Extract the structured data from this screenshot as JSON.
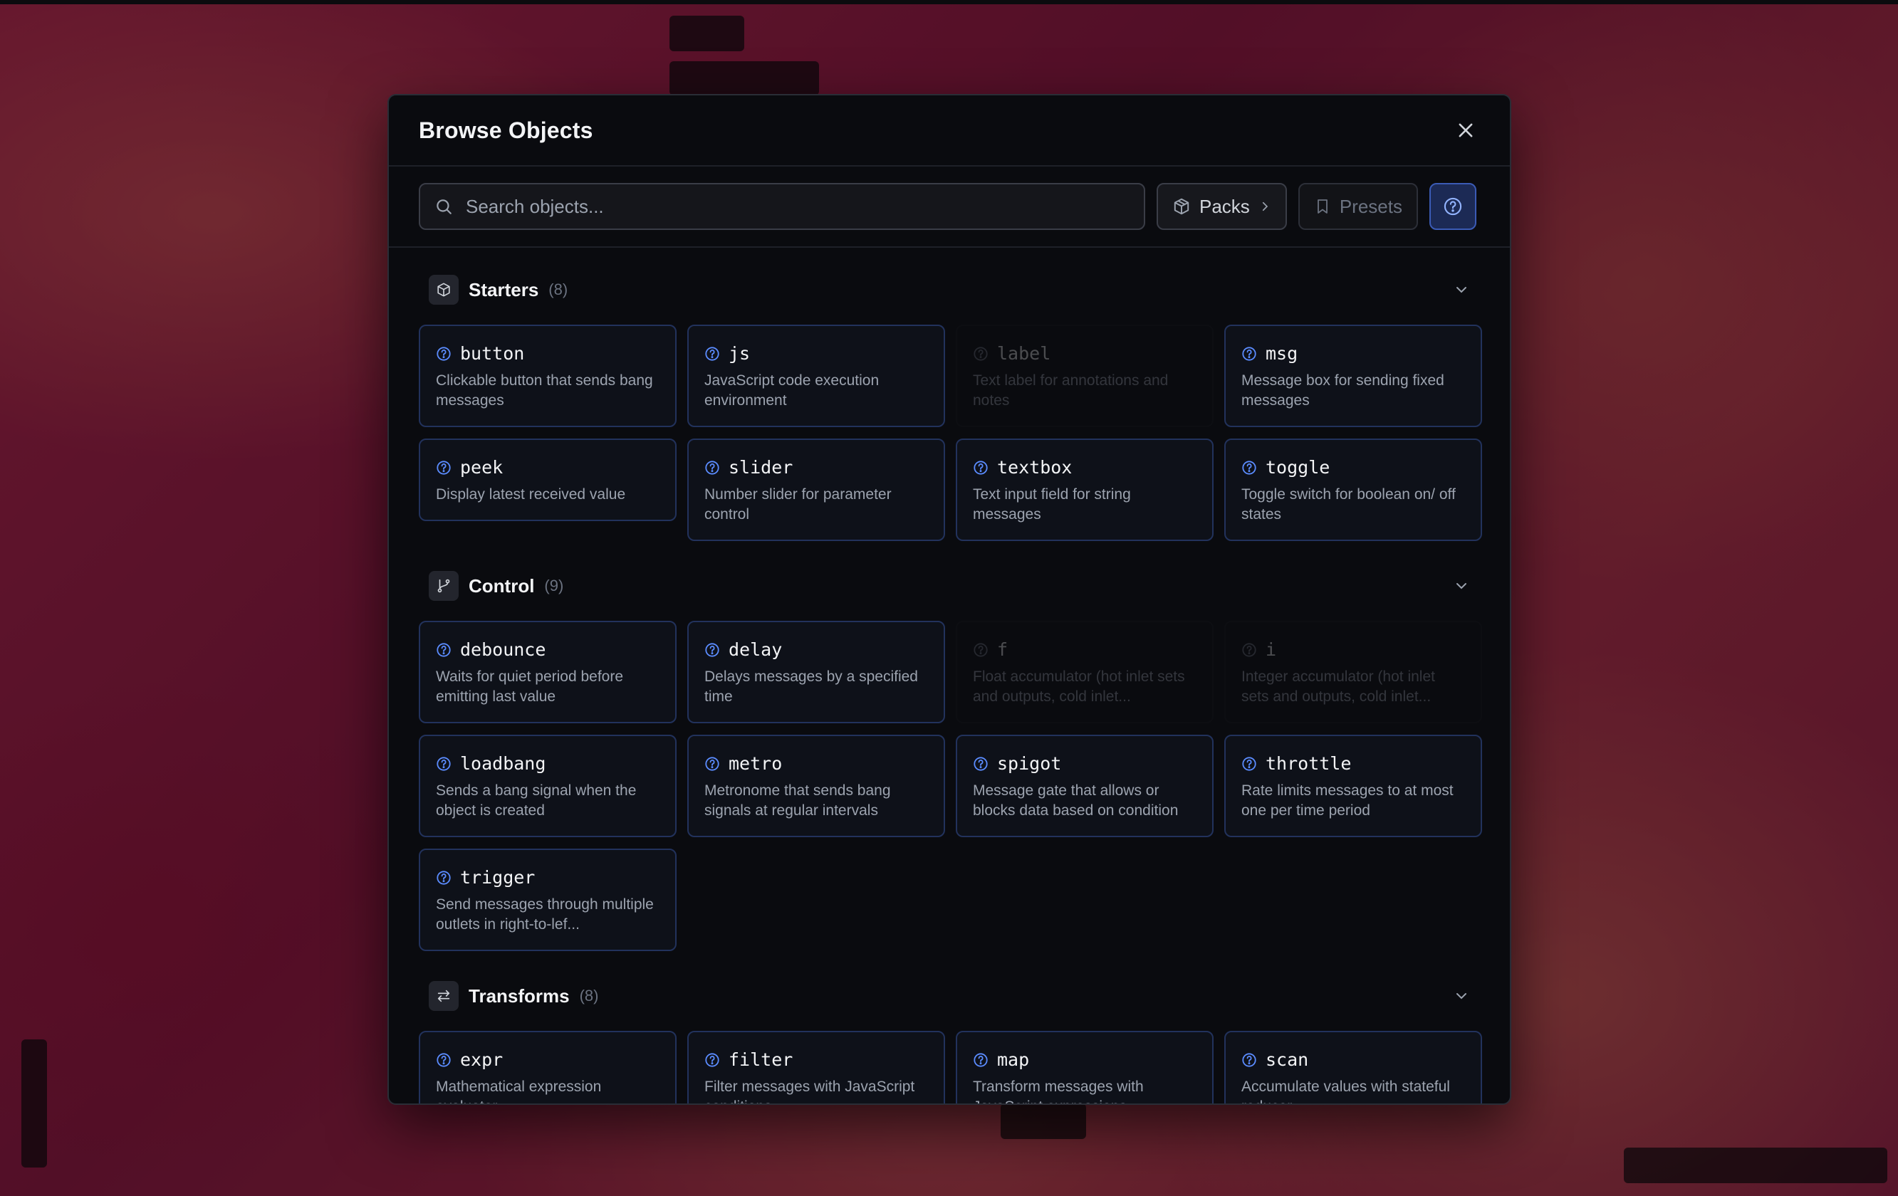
{
  "modal": {
    "title": "Browse Objects"
  },
  "toolbar": {
    "search_placeholder": "Search objects...",
    "packs_label": "Packs",
    "presets_label": "Presets"
  },
  "sections": [
    {
      "title": "Starters",
      "count": "(8)",
      "items": [
        {
          "name": "button",
          "desc": "Clickable button that sends bang messages"
        },
        {
          "name": "js",
          "desc": "JavaScript code execution environment"
        },
        {
          "name": "label",
          "desc": "Text label for annotations and notes"
        },
        {
          "name": "msg",
          "desc": "Message box for sending fixed messages"
        },
        {
          "name": "peek",
          "desc": "Display latest received value"
        },
        {
          "name": "slider",
          "desc": "Number slider for parameter control"
        },
        {
          "name": "textbox",
          "desc": "Text input field for string messages"
        },
        {
          "name": "toggle",
          "desc": "Toggle switch for boolean on/ off states"
        }
      ]
    },
    {
      "title": "Control",
      "count": "(9)",
      "items": [
        {
          "name": "debounce",
          "desc": "Waits for quiet period before emitting last value"
        },
        {
          "name": "delay",
          "desc": "Delays messages by a specified time"
        },
        {
          "name": "f",
          "desc": "Float accumulator (hot inlet sets and outputs, cold inlet..."
        },
        {
          "name": "i",
          "desc": "Integer accumulator (hot inlet sets and outputs, cold inlet..."
        },
        {
          "name": "loadbang",
          "desc": "Sends a bang signal when the object is created"
        },
        {
          "name": "metro",
          "desc": "Metronome that sends bang signals at regular intervals"
        },
        {
          "name": "spigot",
          "desc": "Message gate that allows or blocks data based on condition"
        },
        {
          "name": "throttle",
          "desc": "Rate limits messages to at most one per time period"
        },
        {
          "name": "trigger",
          "desc": "Send messages through multiple outlets in right-to-lef..."
        }
      ]
    },
    {
      "title": "Transforms",
      "count": "(8)",
      "items": [
        {
          "name": "expr",
          "desc": "Mathematical expression evaluator"
        },
        {
          "name": "filter",
          "desc": "Filter messages with JavaScript conditions"
        },
        {
          "name": "map",
          "desc": "Transform messages with JavaScript expressions"
        },
        {
          "name": "scan",
          "desc": "Accumulate values with stateful reducer"
        }
      ]
    }
  ]
}
